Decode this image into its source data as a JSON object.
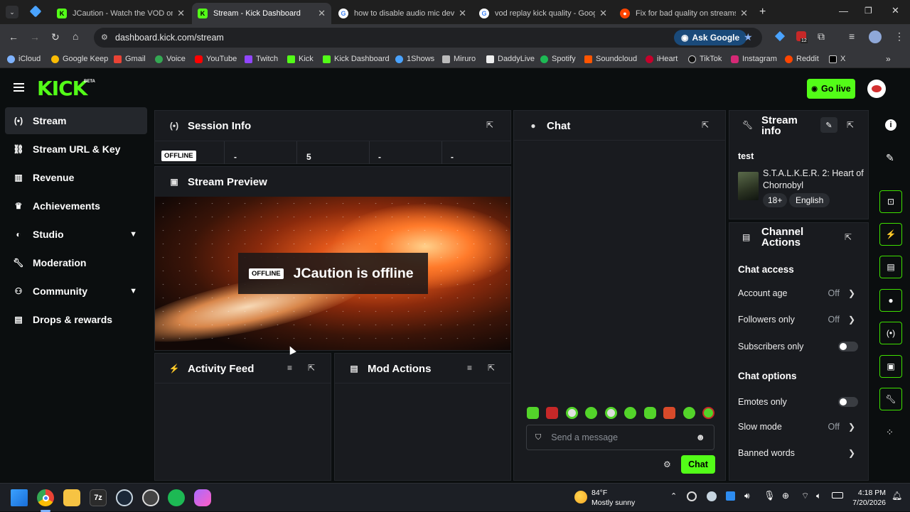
{
  "browser": {
    "tabs": [
      {
        "title": "JCaution - Watch the VOD on K",
        "icon": "kick-favicon",
        "active": false
      },
      {
        "title": "Stream - Kick Dashboard",
        "icon": "kick-favicon",
        "active": true
      },
      {
        "title": "how to disable audio mic devic",
        "icon": "google-favicon",
        "active": false
      },
      {
        "title": "vod replay kick quality - Googl",
        "icon": "google-favicon",
        "active": false
      },
      {
        "title": "Fix for bad quality on streams?",
        "icon": "reddit-favicon",
        "active": false
      }
    ],
    "url": "dashboard.kick.com/stream",
    "ask_google": "Ask Google",
    "extension_badge": "12",
    "bookmarks": [
      "iCloud",
      "Google Keep",
      "Gmail",
      "Voice",
      "YouTube",
      "Twitch",
      "Kick",
      "Kick Dashboard",
      "1Shows",
      "Miruro",
      "DaddyLive",
      "Spotify",
      "Soundcloud",
      "iHeart",
      "TikTok",
      "Instagram",
      "Reddit",
      "X"
    ]
  },
  "header": {
    "logo": "KICK",
    "beta": "BETA",
    "go_live": "Go live"
  },
  "sidebar": {
    "items": [
      {
        "label": "Stream",
        "icon": "broadcast-icon",
        "active": true
      },
      {
        "label": "Stream URL & Key",
        "icon": "link-icon"
      },
      {
        "label": "Revenue",
        "icon": "chart-icon"
      },
      {
        "label": "Achievements",
        "icon": "trophy-icon"
      },
      {
        "label": "Studio",
        "icon": "studio-icon",
        "expandable": true
      },
      {
        "label": "Moderation",
        "icon": "wrench-icon"
      },
      {
        "label": "Community",
        "icon": "community-icon",
        "expandable": true
      },
      {
        "label": "Drops & rewards",
        "icon": "gift-icon"
      }
    ]
  },
  "session_info": {
    "title": "Session Info",
    "status": "OFFLINE",
    "stats": [
      "-",
      "5",
      "-",
      "-"
    ]
  },
  "stream_preview": {
    "title": "Stream Preview",
    "badge": "OFFLINE",
    "message": "JCaution is offline"
  },
  "activity_feed": {
    "title": "Activity Feed"
  },
  "mod_actions": {
    "title": "Mod Actions"
  },
  "chat": {
    "title": "Chat",
    "placeholder": "Send a message",
    "send": "Chat"
  },
  "stream_info": {
    "title_line1": "Stream",
    "title_line2": "info",
    "stream_title": "test",
    "game": "S.T.A.L.K.E.R. 2: Heart of Chornobyl",
    "tags": [
      "18+",
      "English"
    ]
  },
  "channel_actions": {
    "title_line1": "Channel",
    "title_line2": "Actions",
    "chat_access": "Chat access",
    "account_age": {
      "label": "Account age",
      "value": "Off"
    },
    "followers_only": {
      "label": "Followers only",
      "value": "Off"
    },
    "subscribers_only": {
      "label": "Subscribers only",
      "on": false
    },
    "chat_options": "Chat options",
    "emotes_only": {
      "label": "Emotes only",
      "on": false
    },
    "slow_mode": {
      "label": "Slow mode",
      "value": "Off"
    },
    "banned_words": {
      "label": "Banned words"
    }
  },
  "taskbar": {
    "weather_temp": "84°F",
    "weather_desc": "Mostly sunny",
    "time": "4:18 PM",
    "date": "7/20/2026"
  },
  "colors": {
    "accent": "#53fc18",
    "panel": "#191b1f",
    "bg": "#0b0e0f"
  }
}
